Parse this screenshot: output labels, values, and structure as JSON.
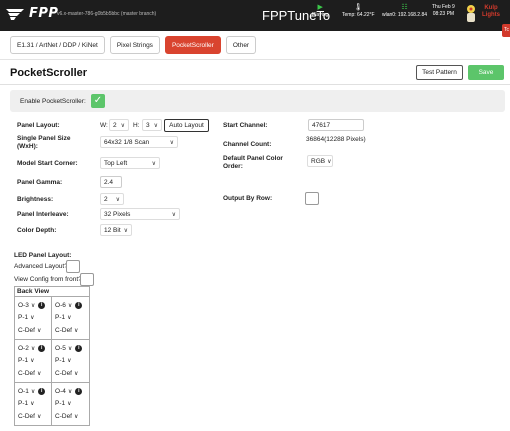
{
  "header": {
    "logo": "FPP",
    "version": "v6.x-master-786-g0b5b5bbc (master branch)",
    "hostname": "FPPTuneTo",
    "playing_label": "Playing",
    "temp_label": "Temp: 64.22°F",
    "wlan_label": "wlan0: 192.168.2.84",
    "date": "Thu Feb 9",
    "time": "08:23 PM",
    "brand_line1": "Kulp",
    "brand_line2": "Lights",
    "corner_tab": "Tc",
    "colors": {
      "bar": "#1d1d1d",
      "accent": "#d23a2c",
      "ok": "#3cc84a"
    }
  },
  "tabs": [
    {
      "label": "E1.31 / ArtNet / DDP / KiNet",
      "active": false
    },
    {
      "label": "Pixel Strings",
      "active": false
    },
    {
      "label": "PocketScroller",
      "active": true
    },
    {
      "label": "Other",
      "active": false
    }
  ],
  "page": {
    "title": "PocketScroller",
    "test_pattern_label": "Test Pattern",
    "save_label": "Save",
    "save_color": "#5cc56a"
  },
  "enable": {
    "label": "Enable PocketScroller:",
    "checked": true
  },
  "form": {
    "panel_layout_label": "Panel Layout:",
    "w_label": "W:",
    "w_value": "2",
    "h_label": "H:",
    "h_value": "3",
    "auto_layout_label": "Auto Layout",
    "panel_size_label_1": "Single Panel Size",
    "panel_size_label_2": "(WxH):",
    "panel_size_value": "64x32 1/8 Scan",
    "start_corner_label": "Model Start Corner:",
    "start_corner_value": "Top Left",
    "gamma_label": "Panel Gamma:",
    "gamma_value": "2.4",
    "brightness_label": "Brightness:",
    "brightness_value": "2",
    "interleave_label": "Panel Interleave:",
    "interleave_value": "32 Pixels",
    "color_depth_label": "Color Depth:",
    "color_depth_value": "12 Bit",
    "start_channel_label": "Start Channel:",
    "start_channel_value": "47617",
    "channel_count_label": "Channel Count:",
    "channel_count_value": "36864(12288 Pixels)",
    "color_order_label_1": "Default Panel Color",
    "color_order_label_2": "Order:",
    "color_order_value": "RGB",
    "output_by_row_label": "Output By Row:"
  },
  "layout": {
    "section_label": "LED Panel Layout:",
    "advanced_label": "Advanced Layout?",
    "view_front_label": "View Config from front?",
    "back_view_label": "Back View",
    "rows": [
      [
        {
          "output": "O-3",
          "panel": "P-1",
          "color": "C-Def"
        },
        {
          "output": "O-6",
          "panel": "P-1",
          "color": "C-Def"
        }
      ],
      [
        {
          "output": "O-2",
          "panel": "P-1",
          "color": "C-Def"
        },
        {
          "output": "O-5",
          "panel": "P-1",
          "color": "C-Def"
        }
      ],
      [
        {
          "output": "O-1",
          "panel": "P-1",
          "color": "C-Def"
        },
        {
          "output": "O-4",
          "panel": "P-1",
          "color": "C-Def"
        }
      ]
    ]
  }
}
